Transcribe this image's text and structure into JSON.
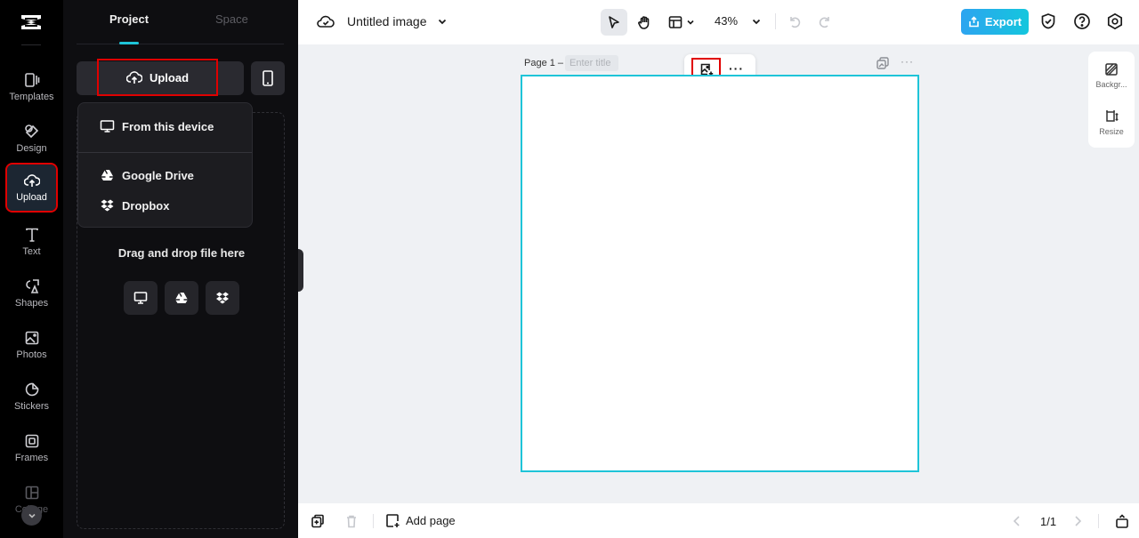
{
  "rail": {
    "items": [
      {
        "label": "Templates",
        "icon": "templates-icon"
      },
      {
        "label": "Design",
        "icon": "design-icon"
      },
      {
        "label": "Upload",
        "icon": "upload-cloud-icon",
        "active": true
      },
      {
        "label": "Text",
        "icon": "text-icon"
      },
      {
        "label": "Shapes",
        "icon": "shapes-icon"
      },
      {
        "label": "Photos",
        "icon": "photos-icon"
      },
      {
        "label": "Stickers",
        "icon": "stickers-icon"
      },
      {
        "label": "Frames",
        "icon": "frames-icon"
      },
      {
        "label": "Collage",
        "icon": "collage-icon"
      }
    ]
  },
  "panel": {
    "tabs": [
      {
        "label": "Project",
        "active": true
      },
      {
        "label": "Space",
        "active": false
      }
    ],
    "upload_label": "Upload",
    "menu": [
      {
        "label": "From this device",
        "icon": "monitor-icon"
      },
      {
        "label": "Google Drive",
        "icon": "google-drive-icon"
      },
      {
        "label": "Dropbox",
        "icon": "dropbox-icon"
      }
    ],
    "dropzone_label": "Drag and drop file here"
  },
  "topbar": {
    "doc_title": "Untitled image",
    "zoom": "43%",
    "export_label": "Export",
    "accent_color": "#1ec4d8"
  },
  "canvas": {
    "page_label": "Page 1 –",
    "title_placeholder": "Enter title"
  },
  "right_panel": {
    "items": [
      {
        "label": "Backgr..."
      },
      {
        "label": "Resize"
      }
    ]
  },
  "bottombar": {
    "add_page_label": "Add page",
    "page_count": "1/1"
  }
}
